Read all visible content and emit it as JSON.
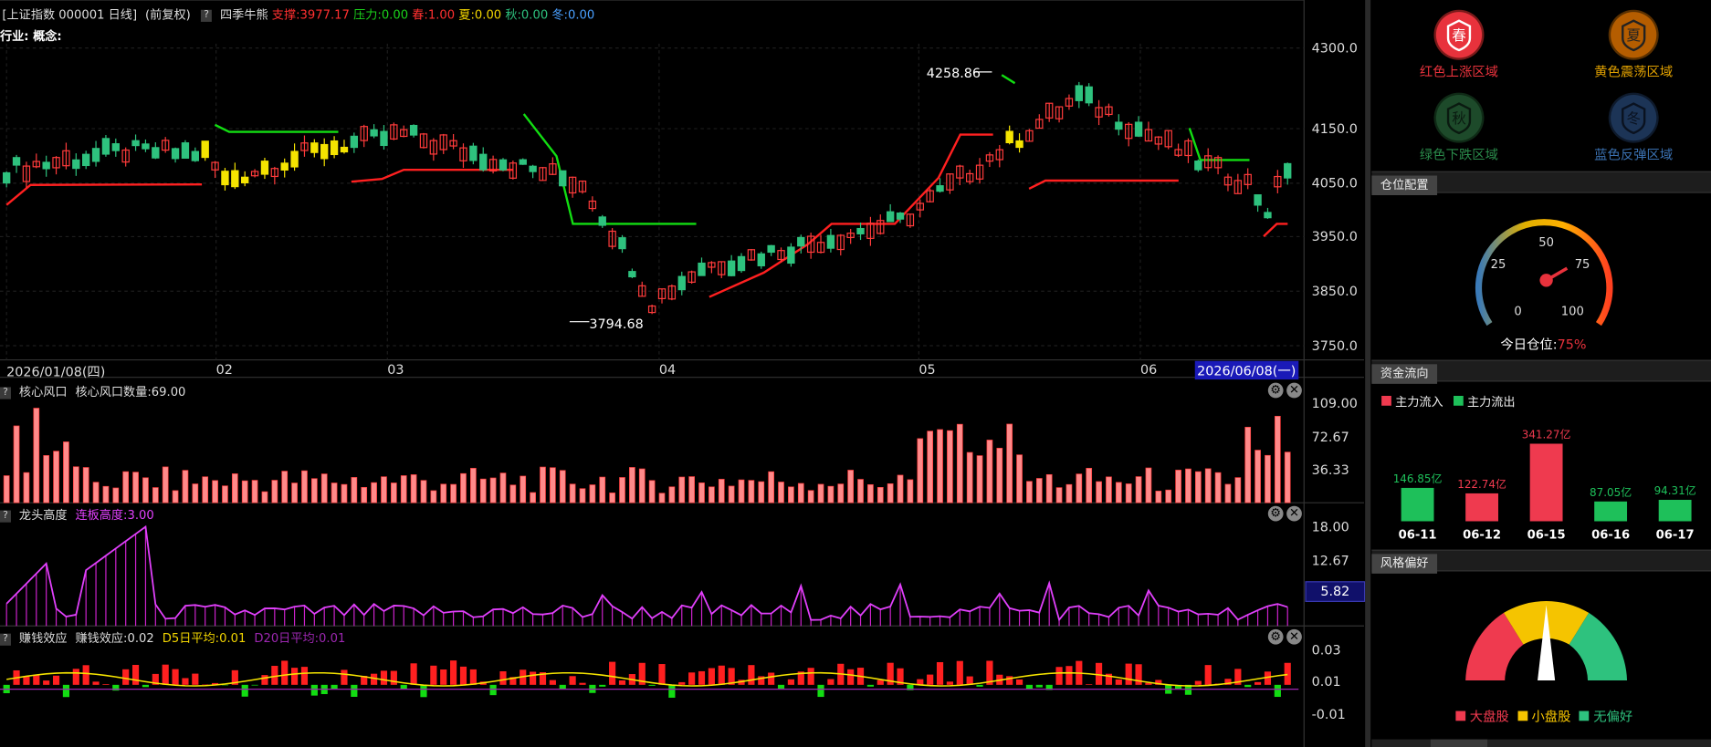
{
  "header": {
    "symbol": "[上证指数 000001 日线]",
    "adjust": "(前复权)",
    "help": "?",
    "indicator": "四季牛熊",
    "support": "支撑:3977.17",
    "pressure": "压力:0.00",
    "spring": "春:1.00",
    "summer": "夏:0.00",
    "autumn": "秋:0.00",
    "winter": "冬:0.00",
    "industry": "行业: 概念:"
  },
  "main_chart": {
    "y_ticks": [
      "4300.0",
      "4150.0",
      "4050.0",
      "3950.0",
      "3850.0",
      "3750.0"
    ],
    "high_label": "4258.86",
    "low_label": "3794.68",
    "x_labels": [
      "2026/01/08(四)",
      "02",
      "03",
      "04",
      "05",
      "06"
    ],
    "cursor_date": "2026/06/08(一)"
  },
  "panel1": {
    "title": "核心风口",
    "value_text": "核心风口数量:69.00",
    "y_ticks": [
      "109.00",
      "72.67",
      "36.33"
    ]
  },
  "panel2": {
    "title": "龙头高度",
    "value_text": "连板高度:3.00",
    "y_ticks": [
      "18.00",
      "12.67"
    ],
    "cursor_value": "5.82"
  },
  "panel3": {
    "title": "赚钱效应",
    "value_text": "赚钱效应:0.02",
    "d5": "D5日平均:0.01",
    "d20": "D20日平均:0.01",
    "y_ticks": [
      "0.03",
      "0.01",
      "-0.01"
    ]
  },
  "seasons": {
    "spring": {
      "glyph": "春",
      "label": "红色上涨区域",
      "color": "#e8323c"
    },
    "summer": {
      "glyph": "夏",
      "label": "黄色震荡区域",
      "color": "#e07b00"
    },
    "autumn": {
      "glyph": "秋",
      "label": "绿色下跌区域",
      "color": "#2a6a3a"
    },
    "winter": {
      "glyph": "冬",
      "label": "蓝色反弹区域",
      "color": "#2a4a7a"
    }
  },
  "position": {
    "section_title": "仓位配置",
    "ticks": [
      "0",
      "25",
      "50",
      "75",
      "100"
    ],
    "label": "今日仓位:",
    "value": "75%",
    "level": 75
  },
  "capital": {
    "section_title": "资金流向",
    "legend_in": "主力流入",
    "legend_out": "主力流出",
    "chart_data": {
      "type": "bar",
      "categories": [
        "06-11",
        "06-12",
        "06-15",
        "06-16",
        "06-17"
      ],
      "values": [
        146.85,
        122.74,
        341.27,
        87.05,
        94.31
      ],
      "labels": [
        "146.85亿",
        "122.74亿",
        "341.27亿",
        "87.05亿",
        "94.31亿"
      ],
      "direction": [
        "out",
        "in",
        "in",
        "out",
        "out"
      ]
    }
  },
  "style": {
    "section_title": "风格偏好",
    "legend": [
      "大盘股",
      "小盘股",
      "无偏好"
    ],
    "colors": [
      "#ef3a4f",
      "#f5c400",
      "#2ec27e"
    ]
  }
}
